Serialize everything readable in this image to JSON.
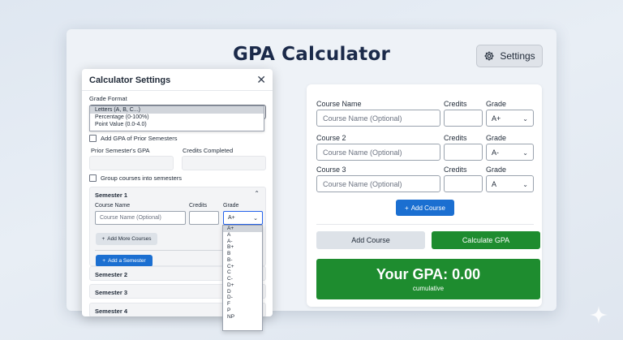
{
  "app": {
    "title": "GPA Calculator",
    "settings_label": "Settings"
  },
  "courses": {
    "label_name": "Course Name",
    "label_credits": "Credits",
    "label_grade": "Grade",
    "rows": [
      {
        "title": "Course Name",
        "placeholder": "Course Name (Optional)",
        "credits": "",
        "grade": "A+"
      },
      {
        "title": "Course 2",
        "placeholder": "Course Name (Optional)",
        "credits": "",
        "grade": "A-"
      },
      {
        "title": "Course 3",
        "placeholder": "Course Name (Optional)",
        "credits": "",
        "grade": "A"
      }
    ],
    "add_small_label": "Add Course",
    "add_big_label": "Add Course",
    "calculate_label": "Calculate GPA"
  },
  "result": {
    "gpa_text": "Your GPA: 0.00",
    "sub_text": "cumulative"
  },
  "settings_panel": {
    "title": "Calculator Settings",
    "close_glyph": "✕",
    "grade_format_label": "Grade Format",
    "grade_format_options": [
      "Letters (A, B, C...)",
      "Percentage (0-100%)",
      "Point Value (0.0-4.0)"
    ],
    "grade_format_selected": "Letters (A, B, C...)",
    "prior_gpa_checkbox": "Add GPA of Prior Semesters",
    "prior_gpa_label": "Prior Semester's GPA",
    "credits_completed_label": "Credits Completed",
    "group_checkbox": "Group courses into semesters",
    "semester1": {
      "title": "Semester 1",
      "course_label": "Course Name",
      "credits_label": "Credits",
      "grade_label": "Grade",
      "course_placeholder": "Course Name (Optional)",
      "grade_value": "A+",
      "add_more_label": "Add More Courses",
      "add_semester_label": "Add a Semester"
    },
    "other_semesters": [
      "Semester 2",
      "Semester 3",
      "Semester 4"
    ]
  },
  "grade_dropdown": {
    "options": [
      "A+",
      "A",
      "A-",
      "B+",
      "B",
      "B-",
      "C+",
      "C",
      "C-",
      "D+",
      "D",
      "D-",
      "F",
      "P",
      "NP"
    ],
    "highlighted": "A+"
  },
  "colors": {
    "primary_blue": "#1b6fd1",
    "green": "#1e8c2f",
    "title_navy": "#1b2a4a"
  }
}
